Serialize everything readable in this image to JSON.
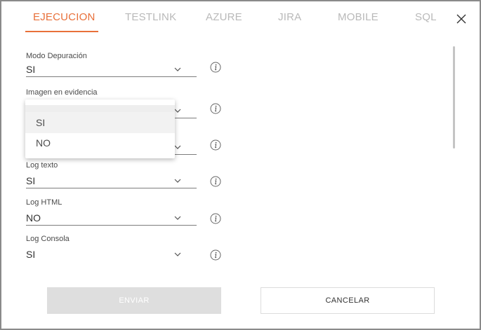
{
  "tabs": [
    {
      "label": "EJECUCION",
      "active": true
    },
    {
      "label": "TESTLINK",
      "active": false
    },
    {
      "label": "AZURE",
      "active": false
    },
    {
      "label": "JIRA",
      "active": false
    },
    {
      "label": "MOBILE",
      "active": false
    },
    {
      "label": "SQL",
      "active": false
    }
  ],
  "fields": [
    {
      "label": "Modo Depuración",
      "value": "SI"
    },
    {
      "label": "Imagen en evidencia",
      "value": ""
    },
    {
      "label": "",
      "value": ""
    },
    {
      "label": "Log texto",
      "value": "SI"
    },
    {
      "label": "Log HTML",
      "value": "NO"
    },
    {
      "label": "Log Consola",
      "value": "SI"
    }
  ],
  "dropdown": {
    "options": [
      "SI",
      "NO"
    ],
    "highlighted": "SI"
  },
  "buttons": {
    "send_label": "ENVIAR",
    "cancel_label": "CANCELAR"
  },
  "icons": {
    "close": "close-icon",
    "chevron": "chevron-down-icon",
    "info": "info-icon"
  },
  "colors": {
    "accent": "#e8703a",
    "tab_inactive": "#b9b9b9",
    "disabled_button": "#dedede"
  }
}
